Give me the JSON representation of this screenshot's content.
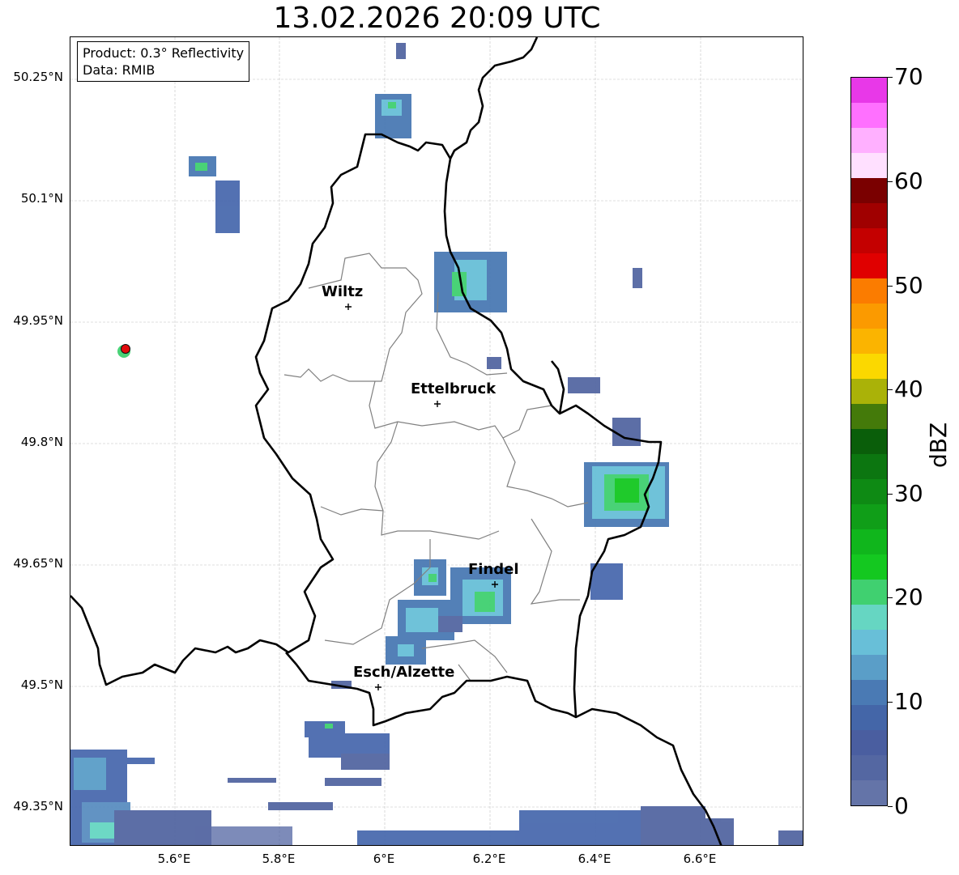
{
  "title": "13.02.2026 20:09 UTC",
  "info_box": {
    "product": "Product: 0.3° Reflectivity",
    "data": "Data: RMIB"
  },
  "y_ticks": [
    "50.25°N",
    "50.1°N",
    "49.95°N",
    "49.8°N",
    "49.65°N",
    "49.5°N",
    "49.35°N"
  ],
  "x_ticks": [
    "5.6°E",
    "5.8°E",
    "6°E",
    "6.2°E",
    "6.4°E",
    "6.6°E"
  ],
  "cities": [
    {
      "name": "Wiltz"
    },
    {
      "name": "Ettelbruck"
    },
    {
      "name": "Findel"
    },
    {
      "name": "Esch/Alzette"
    }
  ],
  "colorbar": {
    "label": "dBZ",
    "tick_labels": [
      "0",
      "10",
      "20",
      "30",
      "40",
      "50",
      "60",
      "70"
    ],
    "colors": [
      "#6474a8",
      "#5467a2",
      "#4a5ea0",
      "#4466a8",
      "#4a7ab4",
      "#5a9ec8",
      "#68bfd8",
      "#66d6c2",
      "#40d070",
      "#14c820",
      "#10b61c",
      "#109e18",
      "#0e8a14",
      "#0c7610",
      "#0a5e0a",
      "#447a0a",
      "#aab208",
      "#fbd800",
      "#fbb400",
      "#fb9a00",
      "#fb7c00",
      "#e00000",
      "#c40000",
      "#a00000",
      "#7a0000",
      "#ffe0ff",
      "#ffb0ff",
      "#ff70ff",
      "#e838e8"
    ]
  },
  "colors": {
    "border": "#000000",
    "admin": "#808080",
    "grid": "#c0c0c0",
    "radar_marker": "#e00000"
  }
}
